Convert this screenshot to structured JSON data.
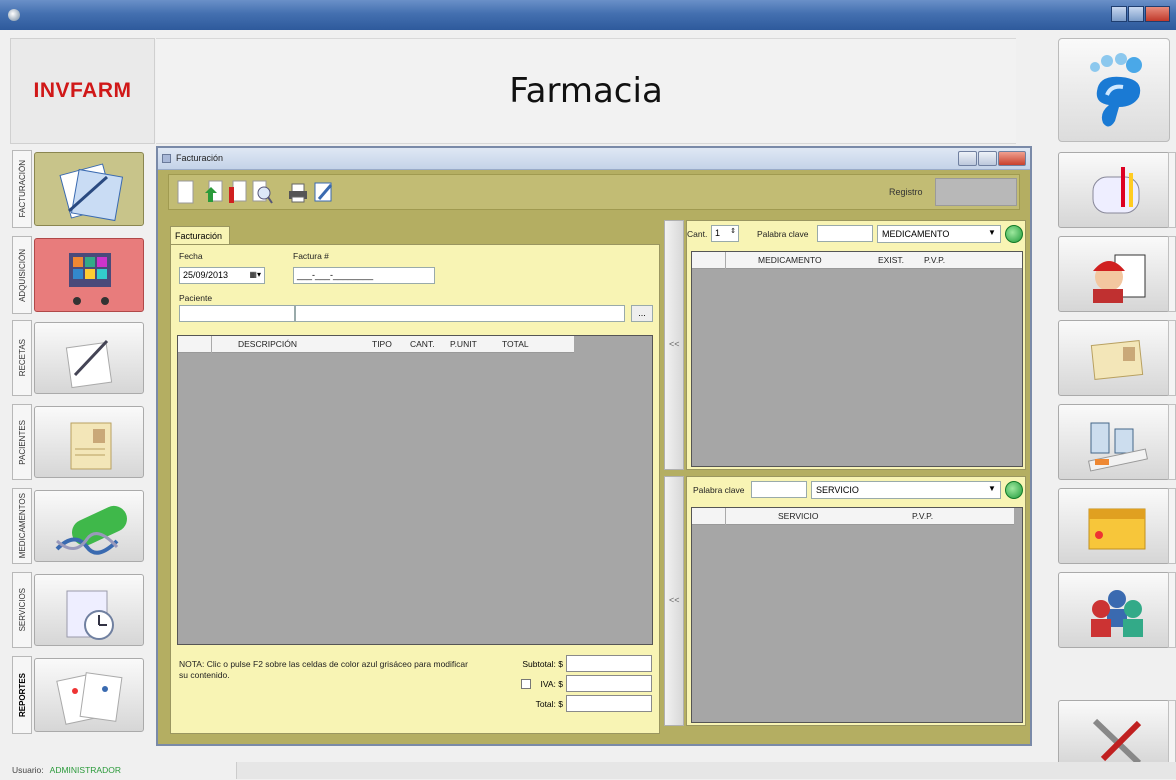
{
  "app": {
    "logo": "INVFARM",
    "title": "Farmacia"
  },
  "left_nav": [
    {
      "tab": "FACTURACIÓN",
      "icon": "invoice-icon"
    },
    {
      "tab": "ADQUISICIÓN",
      "icon": "shopping-cart-icon"
    },
    {
      "tab": "RECETAS",
      "icon": "prescription-icon"
    },
    {
      "tab": "PACIENTES",
      "icon": "patient-card-icon"
    },
    {
      "tab": "MEDICAMENTOS",
      "icon": "pill-capsule-icon"
    },
    {
      "tab": "SERVICIOS",
      "icon": "clock-calendar-icon"
    },
    {
      "tab": "REPORTES",
      "icon": "reports-icon"
    }
  ],
  "right_nav_icons": [
    "mailbox-icon",
    "user-doctor-icon",
    "id-card-icon",
    "medicines-icon",
    "calendar-icon",
    "users-group-icon",
    "tools-icon"
  ],
  "inner_window": {
    "title": "Facturación",
    "registro_label": "Registro"
  },
  "factura": {
    "tab_label": "Facturación",
    "fecha_label": "Fecha",
    "fecha_value": "25/09/2013",
    "factura_label": "Factura #",
    "factura_value": "___-___-________",
    "paciente_label": "Paciente",
    "paciente_button": "...",
    "columns": [
      "DESCRIPCIÓN",
      "TIPO",
      "CANT.",
      "P.UNIT",
      "TOTAL"
    ],
    "nota": "NOTA: Clic o pulse F2 sobre las celdas de color azul grisáceo para modificar su contenido.",
    "subtotal_label": "Subtotal: $",
    "iva_label": "IVA: $",
    "total_label": "Total: $"
  },
  "medicamentos": {
    "cant_label": "Cant.",
    "cant_value": "1",
    "palabra_label": "Palabra clave",
    "combo_value": "MEDICAMENTO",
    "columns": [
      "MEDICAMENTO",
      "EXIST.",
      "P.V.P."
    ]
  },
  "servicios": {
    "palabra_label": "Palabra clave",
    "combo_value": "SERVICIO",
    "columns": [
      "SERVICIO",
      "P.V.P."
    ]
  },
  "splitter_label": "<<",
  "status": {
    "user_label": "Usuario:",
    "user_value": "ADMINISTRADOR"
  }
}
